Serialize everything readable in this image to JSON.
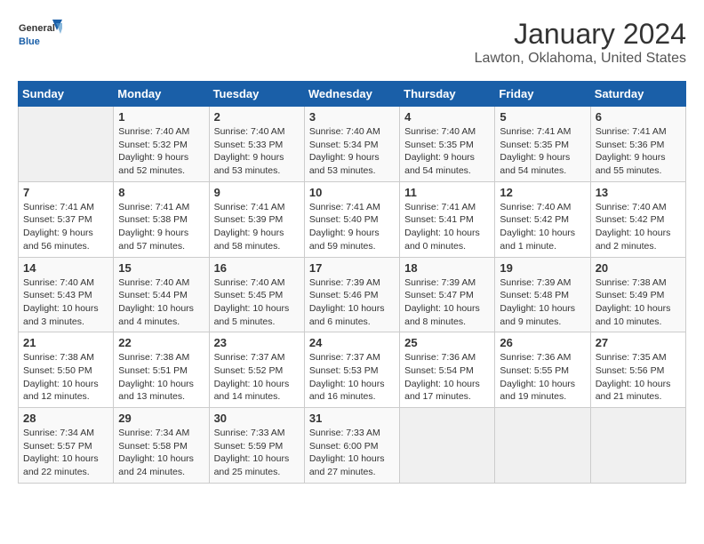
{
  "logo": {
    "text_general": "General",
    "text_blue": "Blue"
  },
  "title": "January 2024",
  "subtitle": "Lawton, Oklahoma, United States",
  "weekdays": [
    "Sunday",
    "Monday",
    "Tuesday",
    "Wednesday",
    "Thursday",
    "Friday",
    "Saturday"
  ],
  "weeks": [
    [
      {
        "day": "",
        "info": ""
      },
      {
        "day": "1",
        "info": "Sunrise: 7:40 AM\nSunset: 5:32 PM\nDaylight: 9 hours\nand 52 minutes."
      },
      {
        "day": "2",
        "info": "Sunrise: 7:40 AM\nSunset: 5:33 PM\nDaylight: 9 hours\nand 53 minutes."
      },
      {
        "day": "3",
        "info": "Sunrise: 7:40 AM\nSunset: 5:34 PM\nDaylight: 9 hours\nand 53 minutes."
      },
      {
        "day": "4",
        "info": "Sunrise: 7:40 AM\nSunset: 5:35 PM\nDaylight: 9 hours\nand 54 minutes."
      },
      {
        "day": "5",
        "info": "Sunrise: 7:41 AM\nSunset: 5:35 PM\nDaylight: 9 hours\nand 54 minutes."
      },
      {
        "day": "6",
        "info": "Sunrise: 7:41 AM\nSunset: 5:36 PM\nDaylight: 9 hours\nand 55 minutes."
      }
    ],
    [
      {
        "day": "7",
        "info": "Sunrise: 7:41 AM\nSunset: 5:37 PM\nDaylight: 9 hours\nand 56 minutes."
      },
      {
        "day": "8",
        "info": "Sunrise: 7:41 AM\nSunset: 5:38 PM\nDaylight: 9 hours\nand 57 minutes."
      },
      {
        "day": "9",
        "info": "Sunrise: 7:41 AM\nSunset: 5:39 PM\nDaylight: 9 hours\nand 58 minutes."
      },
      {
        "day": "10",
        "info": "Sunrise: 7:41 AM\nSunset: 5:40 PM\nDaylight: 9 hours\nand 59 minutes."
      },
      {
        "day": "11",
        "info": "Sunrise: 7:41 AM\nSunset: 5:41 PM\nDaylight: 10 hours\nand 0 minutes."
      },
      {
        "day": "12",
        "info": "Sunrise: 7:40 AM\nSunset: 5:42 PM\nDaylight: 10 hours\nand 1 minute."
      },
      {
        "day": "13",
        "info": "Sunrise: 7:40 AM\nSunset: 5:42 PM\nDaylight: 10 hours\nand 2 minutes."
      }
    ],
    [
      {
        "day": "14",
        "info": "Sunrise: 7:40 AM\nSunset: 5:43 PM\nDaylight: 10 hours\nand 3 minutes."
      },
      {
        "day": "15",
        "info": "Sunrise: 7:40 AM\nSunset: 5:44 PM\nDaylight: 10 hours\nand 4 minutes."
      },
      {
        "day": "16",
        "info": "Sunrise: 7:40 AM\nSunset: 5:45 PM\nDaylight: 10 hours\nand 5 minutes."
      },
      {
        "day": "17",
        "info": "Sunrise: 7:39 AM\nSunset: 5:46 PM\nDaylight: 10 hours\nand 6 minutes."
      },
      {
        "day": "18",
        "info": "Sunrise: 7:39 AM\nSunset: 5:47 PM\nDaylight: 10 hours\nand 8 minutes."
      },
      {
        "day": "19",
        "info": "Sunrise: 7:39 AM\nSunset: 5:48 PM\nDaylight: 10 hours\nand 9 minutes."
      },
      {
        "day": "20",
        "info": "Sunrise: 7:38 AM\nSunset: 5:49 PM\nDaylight: 10 hours\nand 10 minutes."
      }
    ],
    [
      {
        "day": "21",
        "info": "Sunrise: 7:38 AM\nSunset: 5:50 PM\nDaylight: 10 hours\nand 12 minutes."
      },
      {
        "day": "22",
        "info": "Sunrise: 7:38 AM\nSunset: 5:51 PM\nDaylight: 10 hours\nand 13 minutes."
      },
      {
        "day": "23",
        "info": "Sunrise: 7:37 AM\nSunset: 5:52 PM\nDaylight: 10 hours\nand 14 minutes."
      },
      {
        "day": "24",
        "info": "Sunrise: 7:37 AM\nSunset: 5:53 PM\nDaylight: 10 hours\nand 16 minutes."
      },
      {
        "day": "25",
        "info": "Sunrise: 7:36 AM\nSunset: 5:54 PM\nDaylight: 10 hours\nand 17 minutes."
      },
      {
        "day": "26",
        "info": "Sunrise: 7:36 AM\nSunset: 5:55 PM\nDaylight: 10 hours\nand 19 minutes."
      },
      {
        "day": "27",
        "info": "Sunrise: 7:35 AM\nSunset: 5:56 PM\nDaylight: 10 hours\nand 21 minutes."
      }
    ],
    [
      {
        "day": "28",
        "info": "Sunrise: 7:34 AM\nSunset: 5:57 PM\nDaylight: 10 hours\nand 22 minutes."
      },
      {
        "day": "29",
        "info": "Sunrise: 7:34 AM\nSunset: 5:58 PM\nDaylight: 10 hours\nand 24 minutes."
      },
      {
        "day": "30",
        "info": "Sunrise: 7:33 AM\nSunset: 5:59 PM\nDaylight: 10 hours\nand 25 minutes."
      },
      {
        "day": "31",
        "info": "Sunrise: 7:33 AM\nSunset: 6:00 PM\nDaylight: 10 hours\nand 27 minutes."
      },
      {
        "day": "",
        "info": ""
      },
      {
        "day": "",
        "info": ""
      },
      {
        "day": "",
        "info": ""
      }
    ]
  ]
}
